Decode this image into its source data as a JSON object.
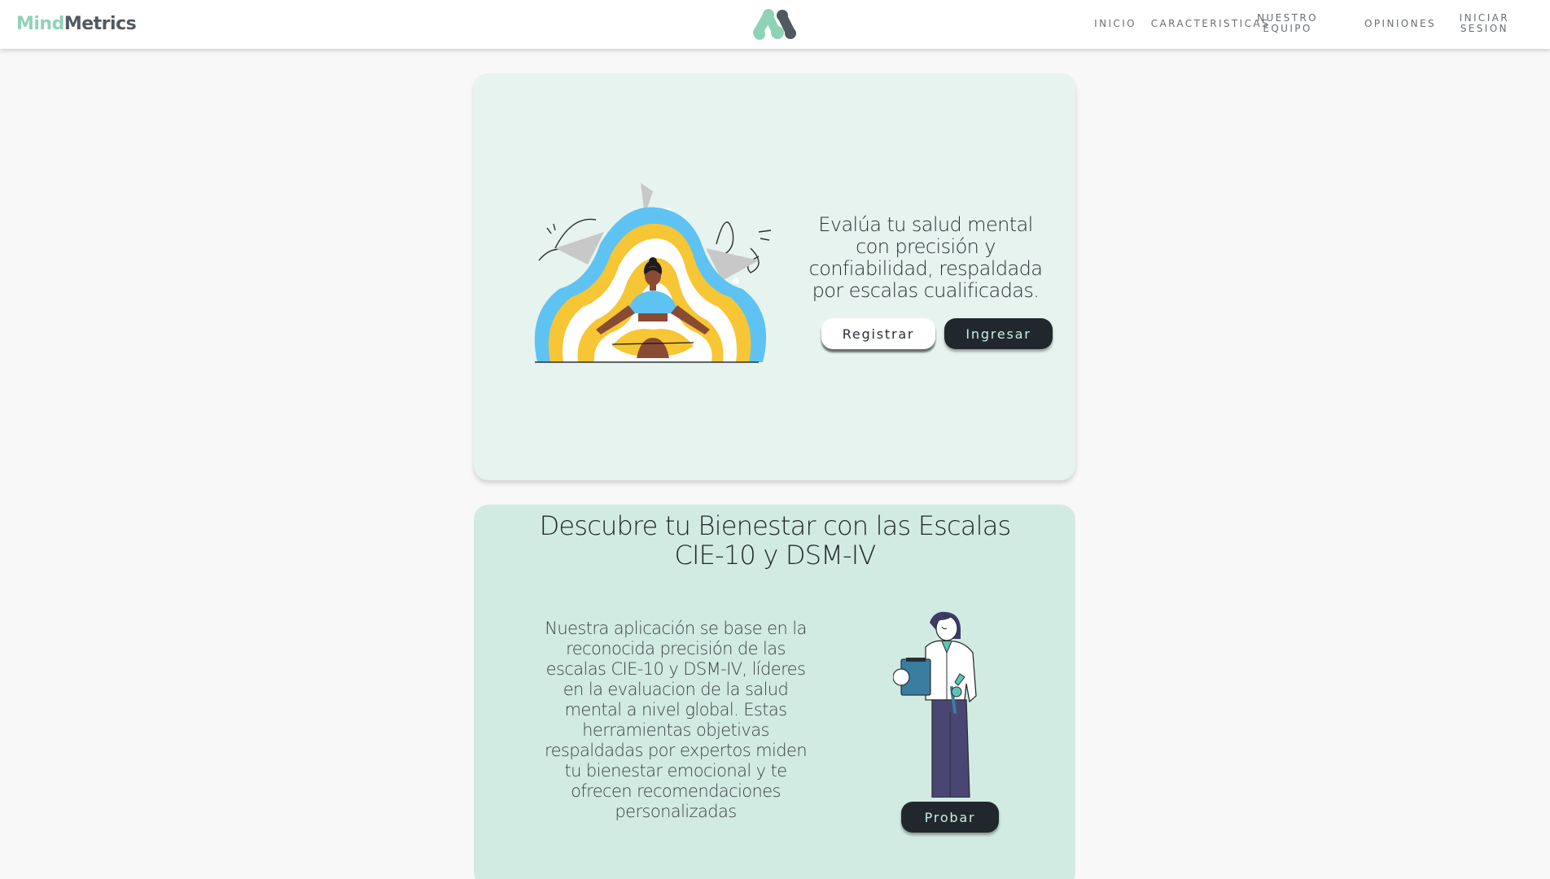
{
  "navbar": {
    "brand_part1": "Mind",
    "brand_part2": "Metrics",
    "links": {
      "inicio": "INICIO",
      "caracteristicas": "CARACTERISTICAS",
      "nuestro_equipo_1": "NUESTRO",
      "nuestro_equipo_2": "EQUIPO",
      "opiniones": "OPINIONES",
      "iniciar_sesion_1": "INICIAR",
      "iniciar_sesion_2": "SESION"
    }
  },
  "hero": {
    "headline": "Evalúa tu salud mental con precisión y confiabilidad, respaldada por escalas cualificadas.",
    "register_label": "Registrar",
    "login_label": "Ingresar"
  },
  "info": {
    "title": "Descubre tu Bienestar con las Escalas CIE-10 y DSM-IV",
    "body": "Nuestra aplicación se base en la reconocida precisión de las escalas CIE-10 y DSM-IV, líderes en la evaluacion de la salud mental a nivel global. Estas herramientas objetivas respaldadas por expertos miden tu bienestar emocional y te ofrecen recomendaciones personalizadas",
    "try_label": "Probar"
  },
  "colors": {
    "brand_green": "#8fd3b6",
    "brand_gray": "#4f5960",
    "hero_bg": "#e6f3ef",
    "info_bg": "#d1ebe2",
    "dark_button": "#21282d",
    "illustration_blue": "#5ec3f2",
    "illustration_yellow": "#f7c634"
  },
  "icons": {
    "logo": "mindmetrics-logo-icon",
    "hero_illustration": "meditating-woman-illustration",
    "info_illustration": "doctor-with-clipboard-illustration"
  }
}
